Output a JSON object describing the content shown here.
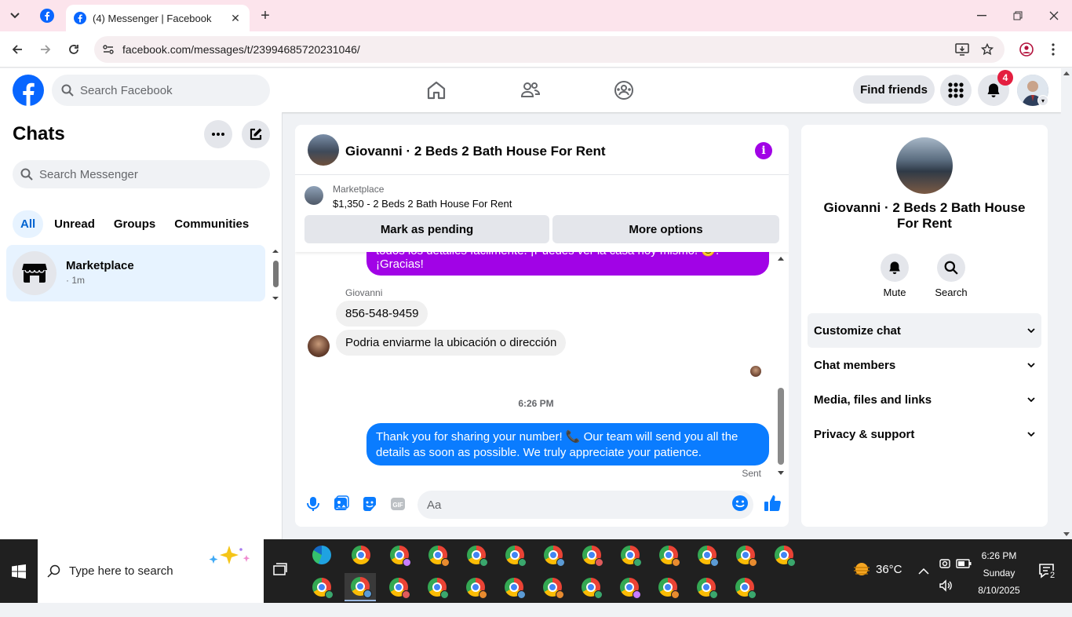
{
  "browser": {
    "tab_title": "(4) Messenger | Facebook",
    "url": "facebook.com/messages/t/23994685720231046/"
  },
  "header": {
    "search_placeholder": "Search Facebook",
    "find_friends": "Find friends",
    "notification_count": "4"
  },
  "sidebar": {
    "title": "Chats",
    "search_placeholder": "Search Messenger",
    "filters": [
      "All",
      "Unread",
      "Groups",
      "Communities"
    ],
    "active_filter": "All",
    "chats": [
      {
        "name": "Marketplace",
        "sub": "· 1m"
      }
    ]
  },
  "conversation": {
    "title": "Giovanni · 2 Beds 2 Bath House For Rent",
    "marketplace_label": "Marketplace",
    "listing": "$1,350 - 2 Beds 2 Bath House For Rent",
    "mark_pending": "Mark as pending",
    "more_options": "More options",
    "messages": {
      "out_top": "todos los detalles fácilmente. ¡Puedes ver la casa hoy mismo! 😊. ¡Gracias!",
      "sender": "Giovanni",
      "in_1": "856-548-9459",
      "in_2": "Podria enviarme la ubicación o dirección",
      "time": "6:26 PM",
      "out_last": "Thank you for sharing your number! 📞 Our team will send you all the details as soon as possible. We truly appreciate your patience.",
      "status": "Sent"
    },
    "composer_placeholder": "Aa"
  },
  "info_panel": {
    "name": "Giovanni · 2 Beds 2 Bath House For Rent",
    "actions": [
      "Mute",
      "Search"
    ],
    "sections": [
      "Customize chat",
      "Chat members",
      "Media, files and links",
      "Privacy & support"
    ]
  },
  "taskbar": {
    "search_placeholder": "Type here to search",
    "temperature": "36°C",
    "time": "6:26 PM",
    "day": "Sunday",
    "date": "8/10/2025",
    "notification_count": "2"
  },
  "colors": {
    "facebook_blue": "#0866ff",
    "purple_bubble": "#a103e6",
    "blue_bubble": "#0a7cff",
    "taskbar": "#202020"
  }
}
